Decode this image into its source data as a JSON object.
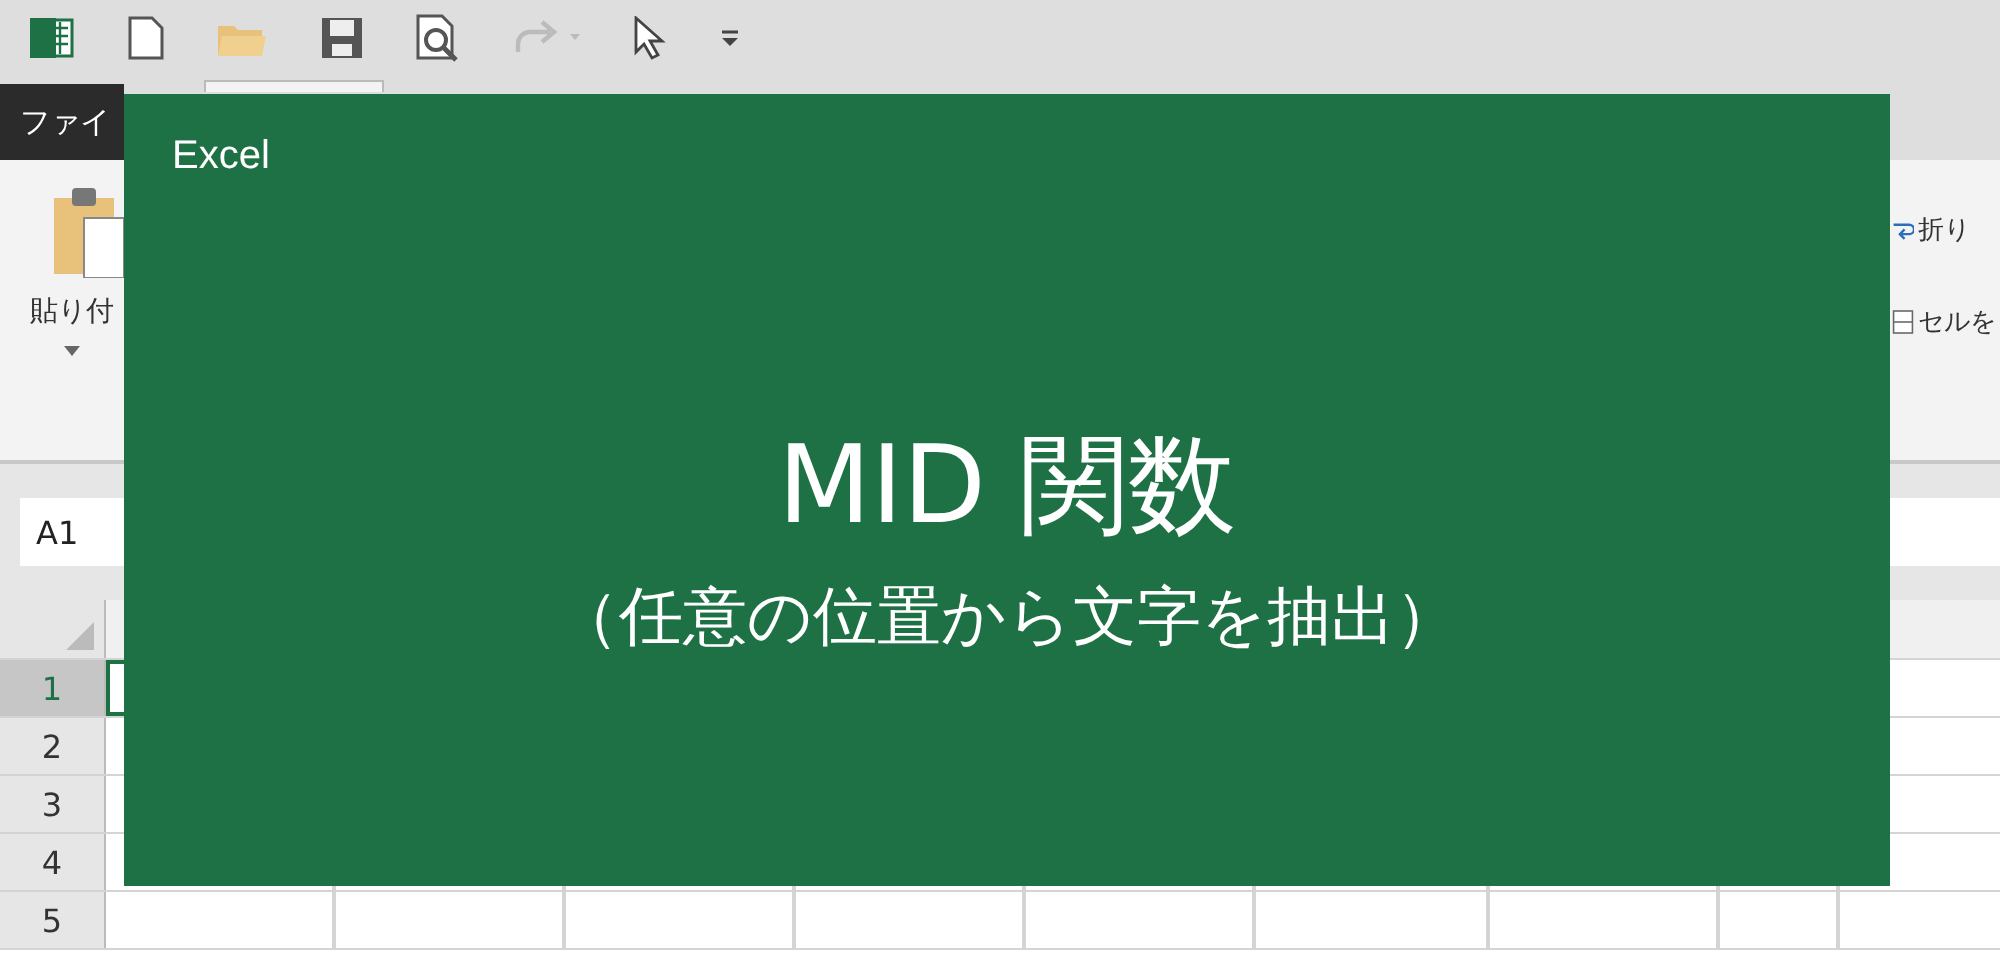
{
  "ribbon_tabs": [
    {
      "label": "ファイ",
      "kind": "file"
    },
    {
      "kind": "home"
    }
  ],
  "ribbon": {
    "paste_label": "貼り付",
    "commands": [
      "折り",
      "セルを"
    ]
  },
  "name_box": {
    "value": "A1"
  },
  "sheet": {
    "rows": [
      {
        "header": "1",
        "selected": true
      },
      {
        "header": "2",
        "selected": false
      },
      {
        "header": "3",
        "selected": false
      },
      {
        "header": "4",
        "selected": false
      },
      {
        "header": "5",
        "selected": false
      }
    ]
  },
  "overlay": {
    "brand": "Excel",
    "title": "MID 関数",
    "subtitle": "（任意の位置から文字を抽出）"
  }
}
